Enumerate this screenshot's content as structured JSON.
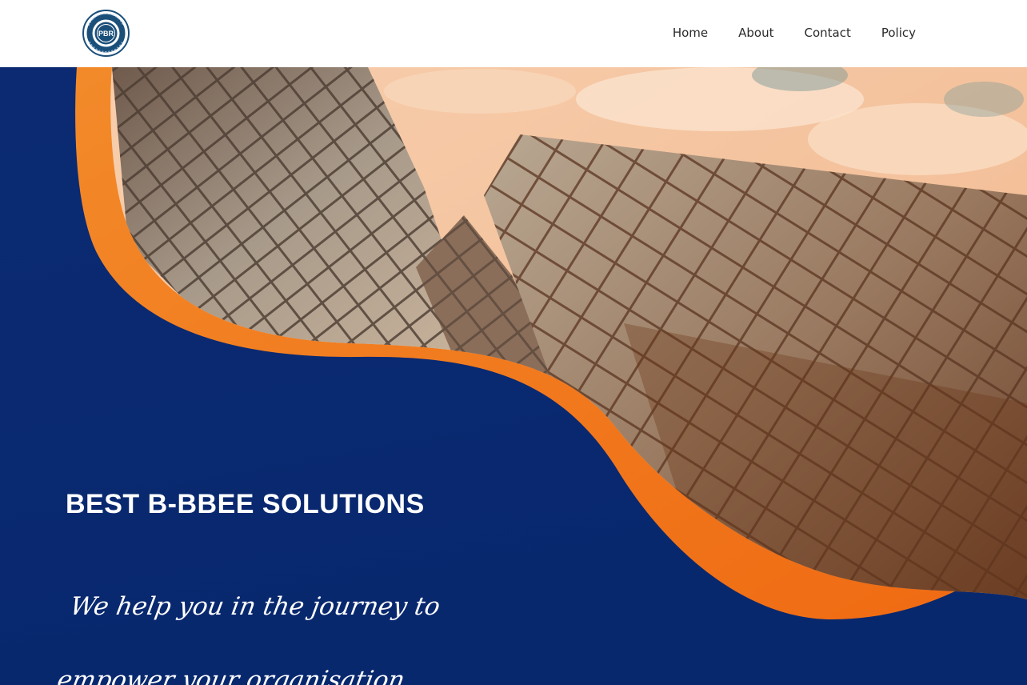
{
  "brand": {
    "logo_text": "PBR",
    "colors": {
      "navy": "#0a2a6e",
      "orange": "#f07a1e",
      "peach": "#f6c9a6"
    }
  },
  "nav": {
    "items": [
      {
        "label": "Home"
      },
      {
        "label": "About"
      },
      {
        "label": "Contact"
      },
      {
        "label": "Policy"
      }
    ]
  },
  "hero": {
    "title": "BEST B-BBEE SOLUTIONS",
    "tagline": "We help you in the journey to empower your organisation"
  }
}
